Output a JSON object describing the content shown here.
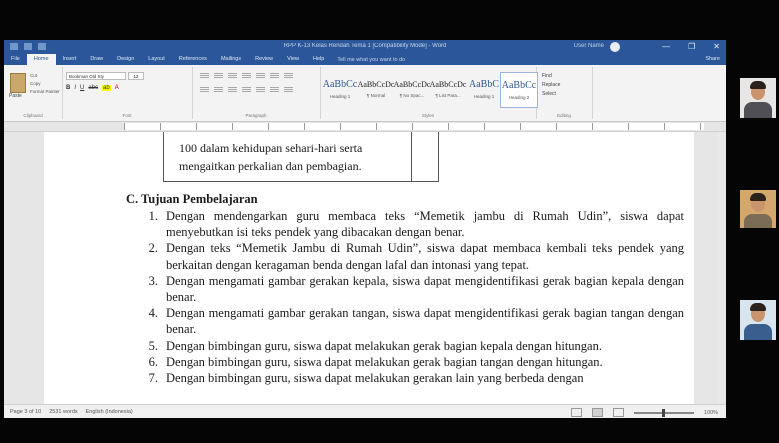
{
  "window": {
    "title": "RPP K-13 Kelas Rendah Tema 1 [Compatibility Mode] - Word",
    "user": "User Name",
    "controls": [
      "—",
      "❐",
      "✕"
    ]
  },
  "tabs": [
    "File",
    "Home",
    "Insert",
    "Draw",
    "Design",
    "Layout",
    "References",
    "Mailings",
    "Review",
    "View",
    "Help"
  ],
  "active_tab_index": 1,
  "tell_me": "Tell me what you want to do",
  "share": "Share",
  "ribbon": {
    "clipboard": {
      "label": "Clipboard",
      "paste": "Paste",
      "cut": "Cut",
      "copy": "Copy",
      "format_painter": "Format Painter"
    },
    "font": {
      "label": "Font",
      "name": "Bookman Old Sty",
      "size": "12"
    },
    "paragraph": {
      "label": "Paragraph"
    },
    "styles": {
      "label": "Styles",
      "items": [
        {
          "sample": "AaBbCc",
          "name": "Heading 1"
        },
        {
          "sample": "AaBbCcDc",
          "name": "¶ Normal"
        },
        {
          "sample": "AaBbCcDc",
          "name": "¶ No Spac..."
        },
        {
          "sample": "AaBbCcDc",
          "name": "¶ List Para..."
        },
        {
          "sample": "AaBbC",
          "name": "Heading 1"
        },
        {
          "sample": "AaBbCc",
          "name": "Heading 2"
        }
      ]
    },
    "editing": {
      "label": "Editing",
      "find": "Find",
      "replace": "Replace",
      "select": "Select"
    }
  },
  "document": {
    "table_cell_text": "100 dalam kehidupan sehari-hari serta mengaitkan perkalian dan pembagian.",
    "section_heading": "C. Tujuan Pembelajaran",
    "objectives": [
      {
        "num": "1.",
        "text": "Dengan mendengarkan guru membaca teks “Memetik jambu di Rumah Udin”, siswa dapat menyebutkan isi teks pendek yang dibacakan dengan benar."
      },
      {
        "num": "2.",
        "text": "Dengan teks “Memetik Jambu di Rumah Udin”, siswa dapat membaca kembali teks pendek yang berkaitan dengan keragaman benda dengan lafal dan intonasi yang tepat."
      },
      {
        "num": "3.",
        "text": "Dengan mengamati gambar gerakan kepala, siswa dapat mengidentifikasi gerak bagian kepala dengan benar."
      },
      {
        "num": "4.",
        "text": "Dengan mengamati gambar gerakan tangan, siswa dapat mengidentifikasi gerak bagian tangan dengan benar."
      },
      {
        "num": "5.",
        "text": "Dengan bimbingan guru, siswa dapat melakukan gerak bagian kepala dengan hitungan."
      },
      {
        "num": "6.",
        "text": "Dengan bimbingan guru, siswa dapat melakukan gerak bagian tangan dengan hitungan."
      },
      {
        "num": "7.",
        "text": "Dengan bimbingan guru, siswa dapat melakukan gerakan lain yang berbeda dengan"
      }
    ]
  },
  "status_bar": {
    "page": "Page 3 of 10",
    "words": "2531 words",
    "language": "English (Indonesia)",
    "zoom": "100%"
  },
  "participants": [
    {
      "name": "participant-1"
    },
    {
      "name": "participant-2"
    },
    {
      "name": "participant-3"
    }
  ]
}
